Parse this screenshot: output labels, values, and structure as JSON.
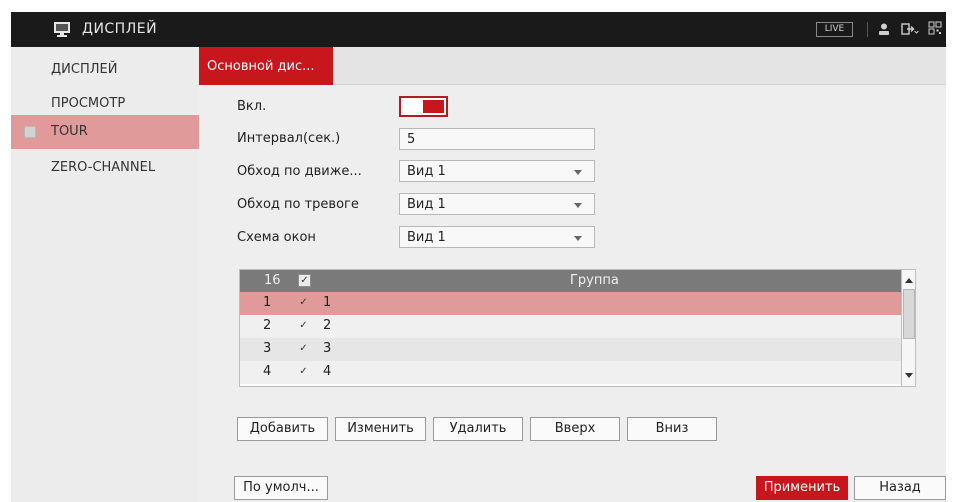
{
  "header": {
    "title": "ДИСПЛЕЙ",
    "live_label": "LIVE",
    "icons": [
      "monitor-icon",
      "user-icon",
      "exit-icon",
      "qr-code-icon"
    ]
  },
  "sidebar": {
    "items": [
      {
        "label": "ДИСПЛЕЙ",
        "active": false
      },
      {
        "label": "ПРОСМОТР",
        "active": false
      },
      {
        "label": "TOUR",
        "active": true
      },
      {
        "label": "ZERO-CHANNEL",
        "active": false
      }
    ]
  },
  "tabs": [
    {
      "label": "Основной дис...",
      "active": true
    }
  ],
  "form": {
    "enable_label": "Вкл.",
    "enable_on": true,
    "interval_label": "Интервал(сек.)",
    "interval_value": "5",
    "motion_label": "Обход по движе...",
    "motion_value": "Вид 1",
    "alarm_label": "Обход по тревоге",
    "alarm_value": "Вид 1",
    "layout_label": "Схема окон",
    "layout_value": "Вид 1"
  },
  "table": {
    "header": {
      "count": "16",
      "group_label": "Группа"
    },
    "rows": [
      {
        "num": "1",
        "name": "1",
        "checked": true,
        "selected": true
      },
      {
        "num": "2",
        "name": "2",
        "checked": true,
        "selected": false
      },
      {
        "num": "3",
        "name": "3",
        "checked": true,
        "selected": false
      },
      {
        "num": "4",
        "name": "4",
        "checked": true,
        "selected": false
      }
    ]
  },
  "actions": {
    "add": "Добавить",
    "edit": "Изменить",
    "delete": "Удалить",
    "up": "Вверх",
    "down": "Вниз"
  },
  "footer": {
    "default_label": "По умолч...",
    "apply_label": "Применить",
    "back_label": "Назад"
  },
  "colors": {
    "accent_red": "#c8161d",
    "selected_row": "#e09a9a",
    "topbar_bg": "#1a1a1a"
  },
  "check_glyph": "✓"
}
